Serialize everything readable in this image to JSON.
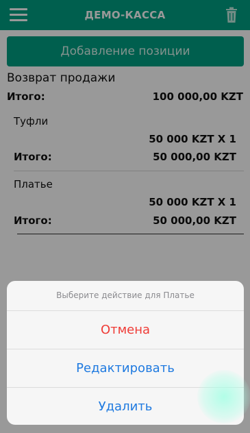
{
  "header": {
    "title": "ДЕМО-КАССА",
    "background": "#009e82"
  },
  "main": {
    "add_button_label": "Добавление позиции",
    "section_title": "Возврат продажи",
    "total_label": "Итого:",
    "total_value": "100 000,00 KZT",
    "items": [
      {
        "name": "Туфли",
        "price_line": "50 000 KZT X 1",
        "total_label": "Итого:",
        "total_value": "50 000,00 KZT"
      },
      {
        "name": "Платье",
        "price_line": "50 000 KZT X 1",
        "total_label": "Итого:",
        "total_value": "50 000,00 KZT"
      }
    ]
  },
  "action_sheet": {
    "title": "Выберите действие для Платье",
    "cancel_label": "Отмена",
    "edit_label": "Редактировать",
    "delete_label": "Удалить",
    "cancel_color": "#ef3b36",
    "action_color": "#1f7ae0"
  }
}
